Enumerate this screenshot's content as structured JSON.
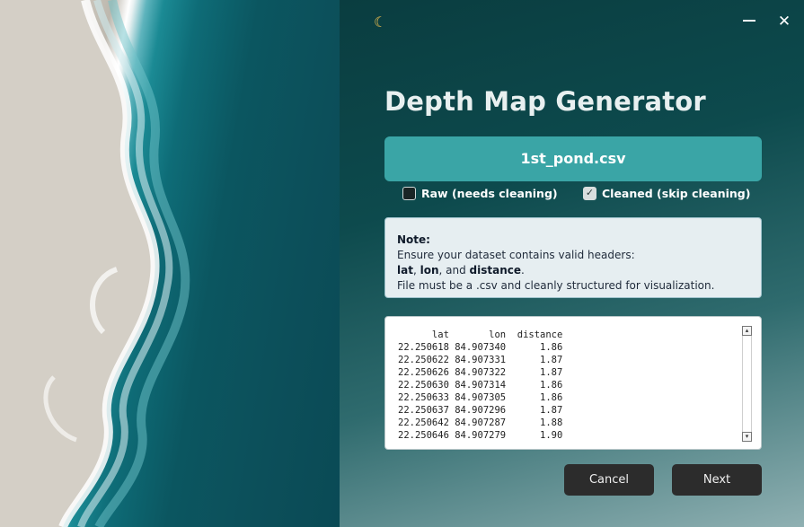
{
  "window": {
    "title_icon": "moon-icon",
    "minimize_icon": "minimize-icon",
    "close_icon": "close-icon",
    "close_glyph": "✕"
  },
  "header": {
    "title": "Depth Map Generator"
  },
  "file": {
    "selected_name": "1st_pond.csv"
  },
  "options": {
    "raw_label": "Raw (needs cleaning)",
    "raw_checked": false,
    "clean_label": "Cleaned (skip cleaning)",
    "clean_checked": true,
    "check_glyph": "✓"
  },
  "note": {
    "heading": "Note:",
    "line1": "Ensure your dataset contains valid headers:",
    "header_lat": "lat",
    "sep1": ", ",
    "header_lon": "lon",
    "sep2": ", and ",
    "header_distance": "distance",
    "sep3": ".",
    "line3": "File must be a .csv and cleanly structured for visualization."
  },
  "preview": {
    "header": "      lat       lon  distance",
    "rows": [
      "22.250618 84.907340      1.86",
      "22.250622 84.907331      1.87",
      "22.250626 84.907322      1.87",
      "22.250630 84.907314      1.86",
      "22.250633 84.907305      1.86",
      "22.250637 84.907296      1.87",
      "22.250642 84.907287      1.88",
      "22.250646 84.907279      1.90"
    ]
  },
  "footer": {
    "cancel_label": "Cancel",
    "next_label": "Next"
  },
  "colors": {
    "accent": "#3aa5a6",
    "button_dark": "#2c2c2c",
    "note_bg": "#e6eef1"
  }
}
